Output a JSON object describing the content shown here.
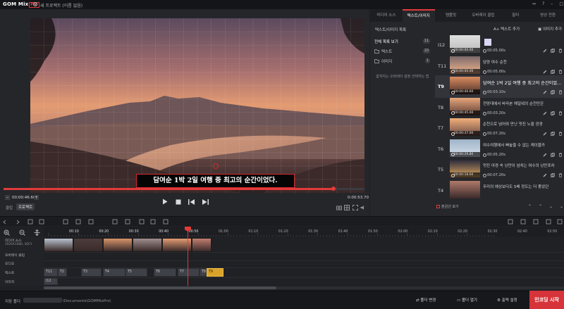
{
  "app": {
    "logo_brand": "GOM Mix",
    "logo_badge": "Pro",
    "project_title": "새 프로젝트 (이름 없음)",
    "window_controls": [
      "↔",
      "?",
      "–",
      "□"
    ]
  },
  "preview": {
    "subtitle": "담여순 1박 2일 여행 중 최고의 순간이었다.",
    "current_time": "00:00:46.60",
    "total_time": "0:00:53.70",
    "progress": 0.914,
    "tab_clip": "클립",
    "tab_project": "프로젝트",
    "minus_label": "–",
    "plus_label": "+"
  },
  "right_panel": {
    "tabs": [
      "미디어 소스",
      "텍스트/이미지",
      "템플릿",
      "오버레이 클립",
      "필터",
      "영상 전환"
    ],
    "active_tab": 1,
    "list_title": "텍스트/이미지 목록",
    "add_text": "텍스트 추가",
    "add_image": "이미지 추가",
    "folders": [
      {
        "name": "전체 목록 보기",
        "count": "11"
      },
      {
        "name": "텍스트",
        "count": "10"
      },
      {
        "name": "이미지",
        "count": "1"
      }
    ],
    "folder_hint": "겹쳐지는 오버레이 설정 선택하는 법",
    "items": [
      {
        "label": "I12",
        "thumb_time": "00:00:00.00",
        "text": "",
        "duration": "00:05.00s",
        "selected": false,
        "image": true
      },
      {
        "label": "T11",
        "thumb_time": "00:00:00.00",
        "text": "담양 여수 순천",
        "duration": "00:05.00s",
        "selected": false
      },
      {
        "label": "T9",
        "thumb_time": "00:00:40.60",
        "text": "담여순 1박 2일 여행 중 최고의 순간이었다.",
        "duration": "00:03.10s",
        "selected": true
      },
      {
        "label": "T8",
        "thumb_time": "00:00:45.00",
        "text": "전망대에서 바라본 해질녘의 순천만은",
        "duration": "00:03.20s",
        "selected": false
      },
      {
        "label": "T7",
        "thumb_time": "00:00:37.00",
        "text": "순천으로 넘어와 만난 멋진 노을 광경",
        "duration": "00:07.20s",
        "selected": false
      },
      {
        "label": "T6",
        "thumb_time": "00:00:29.80",
        "text": "여수여행에서 빠놓을 수 없는 케이블카",
        "duration": "00:05.20s",
        "selected": false
      },
      {
        "label": "T5",
        "thumb_time": "00:00:18.60",
        "text": "멋진 야경 속 낭만이 넘치는 여수의 낭만포차",
        "duration": "00:07.20s",
        "selected": false
      },
      {
        "label": "T4",
        "thumb_time": "",
        "text": "우리의 예상보다도 5배 정도는 더 좋았던",
        "duration": "",
        "selected": false
      }
    ],
    "footer_option": "분금선 보기",
    "nav": [
      "⌃",
      "⌃",
      "⌄",
      "⌄"
    ]
  },
  "timeline": {
    "ticks": [
      "00:10",
      "00:20",
      "00:30",
      "00:40",
      "00:50",
      "01:00",
      "01:10",
      "01:20",
      "01:30",
      "01:40",
      "01:50",
      "02:00",
      "02:10",
      "02:20",
      "02:30",
      "02:40",
      "02:50"
    ],
    "tracks": {
      "media": "미디어 소스",
      "media_sub": "1920X1080, 30CY",
      "overlay": "오버레이 클립",
      "audio": "오디오",
      "text": "텍스트",
      "image": "이미지"
    },
    "text_clips": [
      "T11",
      "T2",
      "T3",
      "T4",
      "T5",
      "T6",
      "T7",
      "T8",
      "T9"
    ],
    "image_clips": [
      "I12"
    ]
  },
  "status": {
    "save_label": "저장 폴더",
    "save_path": "\\Documents\\GOMMixPro\\",
    "change_folder": "폴더 변경",
    "open_folder": "폴더 열기",
    "output_settings": "출력 설정",
    "encode_start": "인코딩 시작"
  },
  "colors": {
    "accent": "#e23a3a",
    "selected_clip": "#d9a22a",
    "panel": "#26272b"
  }
}
